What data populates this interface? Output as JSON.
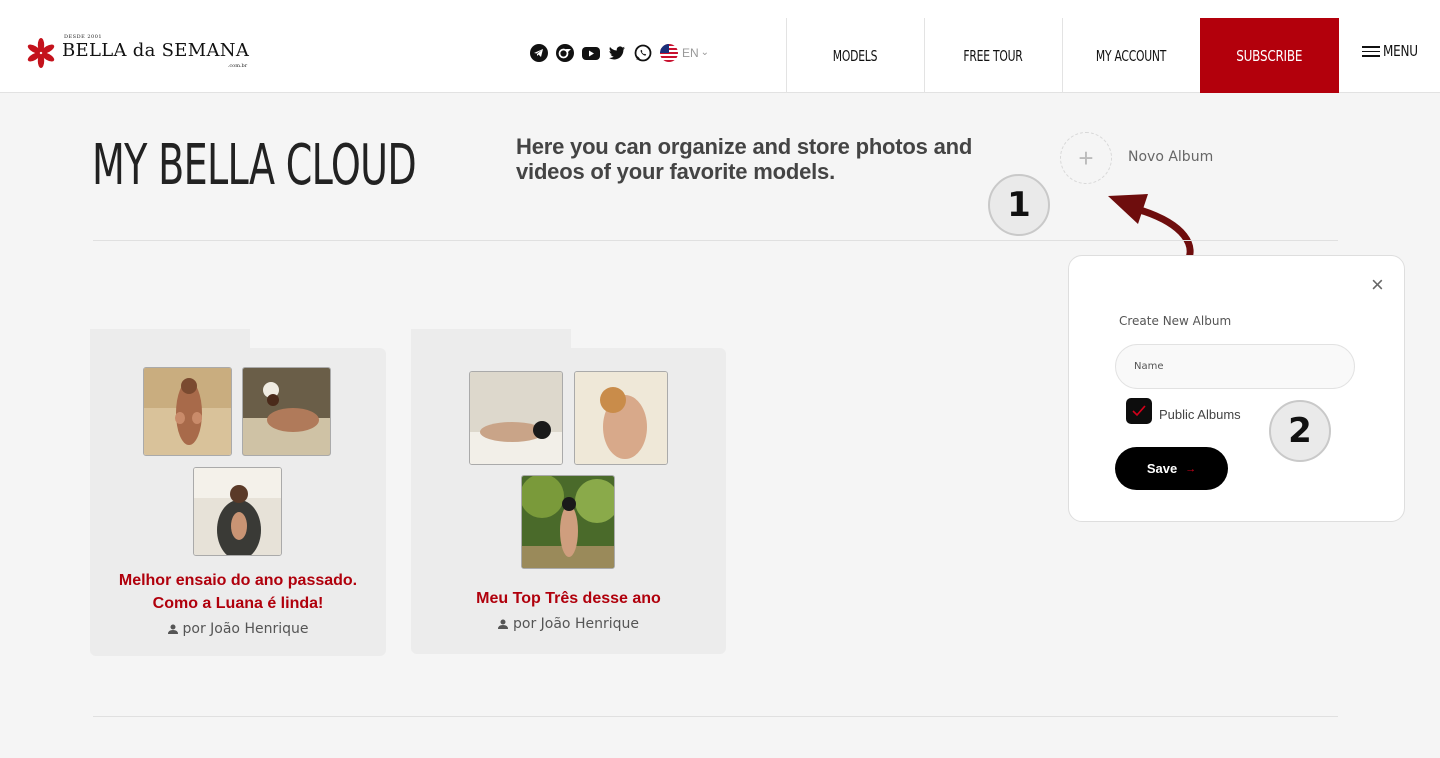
{
  "header": {
    "logo_since": "DESDE 2001",
    "logo_main": "BELLA da SEMANA",
    "logo_domain": ".com.br",
    "social": [
      "telegram-icon",
      "onlyfans-icon",
      "youtube-icon",
      "twitter-icon",
      "whatsapp-icon"
    ],
    "lang": "EN",
    "nav": [
      "MODELS",
      "FREE TOUR",
      "MY ACCOUNT"
    ],
    "subscribe": "SUBSCRIBE",
    "menu": "MENU",
    "accent": "#b3000c"
  },
  "main": {
    "title": "MY BELLA CLOUD",
    "subtitle": "Here you can organize and store photos and videos of your favorite models.",
    "add_plus": "+",
    "add_label": "Novo Album",
    "step1": "1",
    "step2": "2"
  },
  "albums": [
    {
      "title_line1": "Melhor ensaio do ano passado.",
      "title_line2": "Como a Luana é linda!",
      "author": "por João Henrique"
    },
    {
      "title_line1": "Meu Top Três desse ano",
      "title_line2": "",
      "author": "por João Henrique"
    }
  ],
  "popup": {
    "close": "×",
    "label": "Create New Album",
    "name_placeholder": "Name",
    "checkbox_label": "Public Albums",
    "save_label": "Save",
    "save_arrow": "→"
  }
}
